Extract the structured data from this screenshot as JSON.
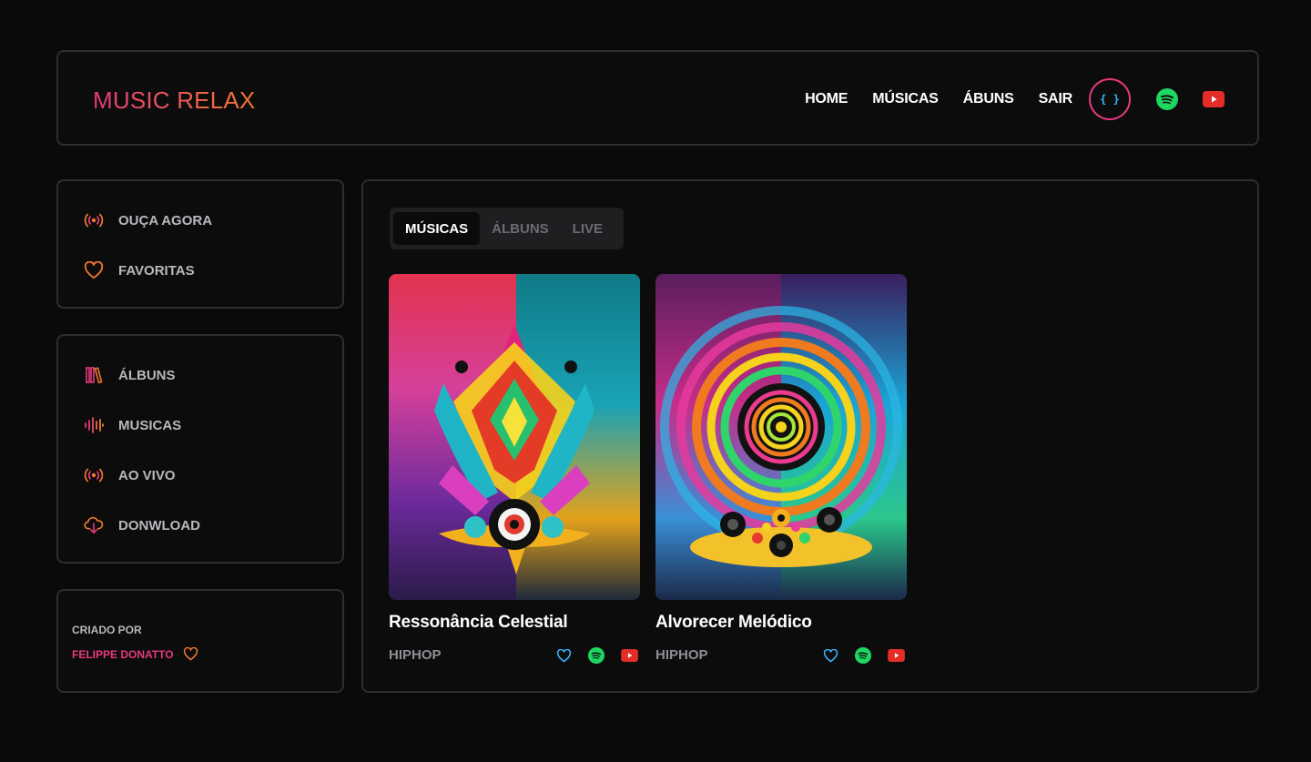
{
  "header": {
    "logo": "MUSIC RELAX",
    "nav": [
      "HOME",
      "MÚSICAS",
      "ÁBUNS",
      "SAIR"
    ],
    "brace_symbol": "{ }"
  },
  "sidebar": {
    "group1": [
      {
        "label": "OUÇA AGORA",
        "icon": "broadcast-icon"
      },
      {
        "label": "FAVORITAS",
        "icon": "heart-icon"
      }
    ],
    "group2": [
      {
        "label": "ÁLBUNS",
        "icon": "library-icon"
      },
      {
        "label": "MUSICAS",
        "icon": "waveform-icon"
      },
      {
        "label": "AO VIVO",
        "icon": "broadcast-icon"
      },
      {
        "label": "DONWLOAD",
        "icon": "cloud-download-icon"
      }
    ],
    "credits": {
      "label": "CRIADO POR",
      "author": "FELIPPE DONATTO"
    }
  },
  "main": {
    "tabs": [
      "MÚSICAS",
      "ÁLBUNS",
      "LIVE"
    ],
    "active_tab": "MÚSICAS",
    "cards": [
      {
        "title": "Ressonância Celestial",
        "genre": "HIPHOP"
      },
      {
        "title": "Alvorecer Melódico",
        "genre": "HIPHOP"
      }
    ]
  },
  "colors": {
    "accent_pink": "#e6397d",
    "accent_orange": "#f0782e",
    "spotify_green": "#1ed760",
    "youtube_red": "#e52d27",
    "heart_blue": "#38b6ff"
  }
}
